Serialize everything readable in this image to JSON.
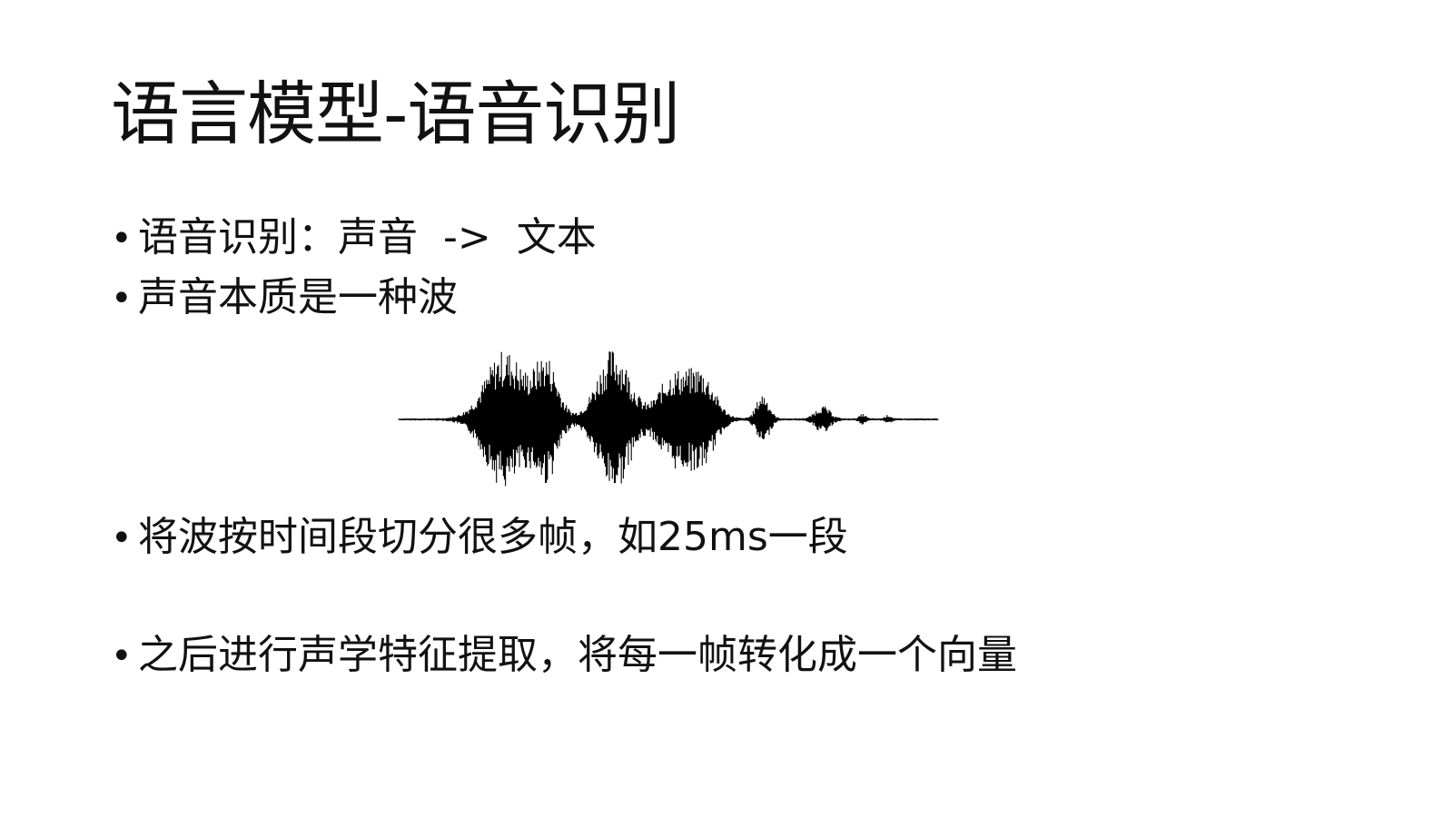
{
  "slide": {
    "title": "语言模型-语音识别",
    "bullets": [
      {
        "marker": "•",
        "text": "语音识别：声音  ->  文本"
      },
      {
        "marker": "•",
        "text": "声音本质是一种波"
      },
      {
        "marker": "•",
        "text": "将波按时间段切分很多帧，如25ms一段"
      },
      {
        "marker": "•",
        "text": "之后进行声学特征提取，将每一帧转化成一个向量"
      }
    ],
    "figure": {
      "icon": "audio-waveform-icon",
      "color": "#000000",
      "baseline_color": "#6a8a8a"
    }
  }
}
